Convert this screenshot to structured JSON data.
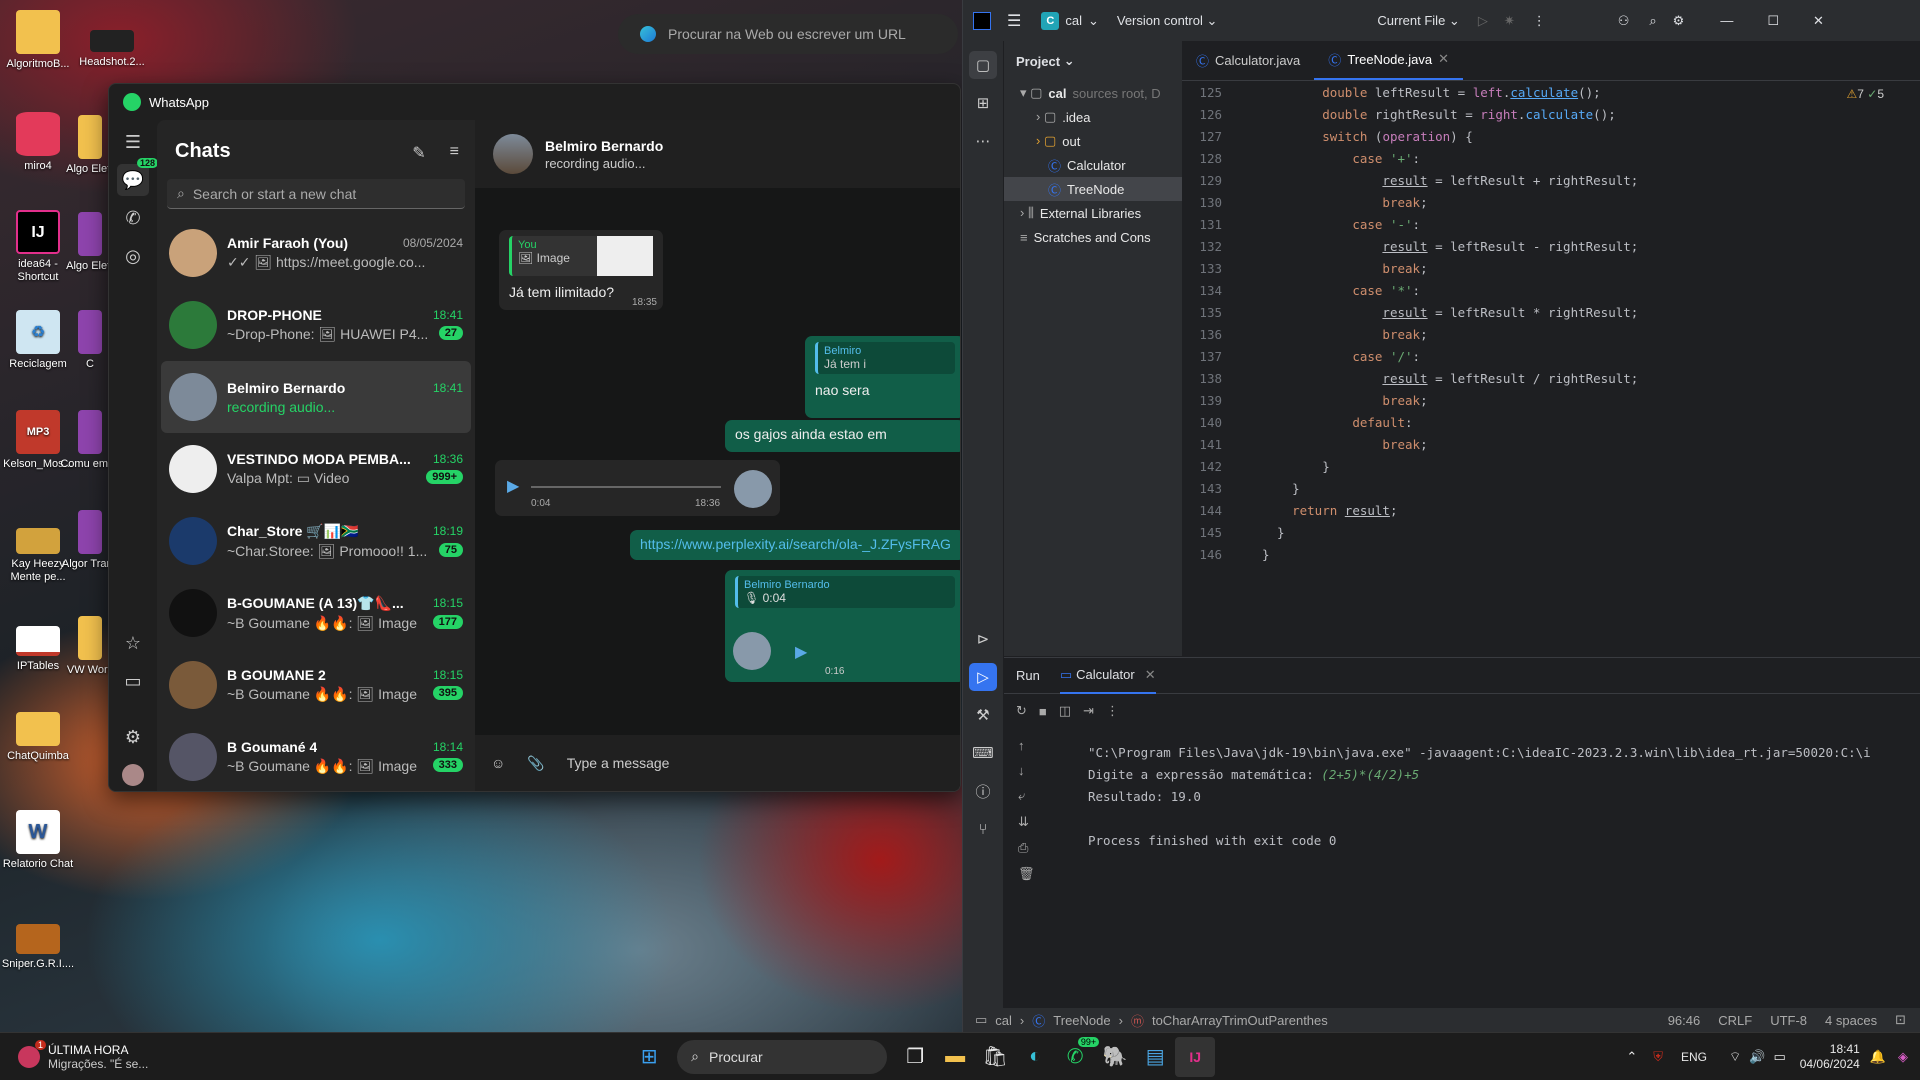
{
  "desktop": {
    "icons": [
      "AlgoritmoB...",
      "Headshot.2...",
      "miro4",
      "Algo Eletr",
      "idea64 - Shortcut",
      "Algo Eletr",
      "Reciclagem",
      "C",
      "Kelson_Mos...",
      "Comu em G",
      "Kay Heezy Mente pe...",
      "Algor Trans",
      "IPTables",
      "VW Work",
      "ChatQuimba",
      "Relatorio Chat",
      "Sniper.G.R.I...."
    ],
    "mp3_label": "MP3"
  },
  "edge": {
    "placeholder": "Procurar na Web ou escrever um URL"
  },
  "whatsapp": {
    "title": "WhatsApp",
    "rail_badge": "128",
    "chats_title": "Chats",
    "search_placeholder": "Search or start a new chat",
    "chats": [
      {
        "name": "Amir Faraoh (You)",
        "time": "08/05/2024",
        "preview": "✓✓ 🖼 https://meet.google.co...",
        "badge": ""
      },
      {
        "name": "DROP-PHONE",
        "time": "18:41",
        "preview": "~Drop-Phone: 🖼 HUAWEI P4...",
        "badge": "27"
      },
      {
        "name": "Belmiro Bernardo",
        "time": "18:41",
        "preview": "recording audio...",
        "badge": ""
      },
      {
        "name": "VESTINDO MODA PEMBA...",
        "time": "18:36",
        "preview": "Valpa Mpt: ▭ Video",
        "badge": "999+"
      },
      {
        "name": "Char_Store 🛒📊🇿🇦",
        "time": "18:19",
        "preview": "~Char.Storee: 🖼 Promooo!! 1...",
        "badge": "75"
      },
      {
        "name": "B-GOUMANE (A 13)👕👠...",
        "time": "18:15",
        "preview": "~B Goumane 🔥🔥: 🖼 Image",
        "badge": "177"
      },
      {
        "name": "B GOUMANE 2",
        "time": "18:15",
        "preview": "~B Goumane 🔥🔥: 🖼 Image",
        "badge": "395"
      },
      {
        "name": "B Goumané 4",
        "time": "18:14",
        "preview": "~B Goumane 🔥🔥: 🖼 Image",
        "badge": "333"
      }
    ],
    "conversation": {
      "contact": "Belmiro Bernardo",
      "status": "recording audio...",
      "quote_you": "You",
      "quote_image": "🖼 Image",
      "msg1": "Já tem ilimitado?",
      "msg1_time": "18:35",
      "reply_label": "Belmiro",
      "reply_text": "Já tem i",
      "msg2": "nao sera",
      "msg3": "os gajos ainda estao em",
      "audio_elapsed": "0:04",
      "audio_time": "18:36",
      "link": "https://www.perplexity.ai/search/ola-_J.ZFysFRAG",
      "quote2_name": "Belmiro Bernardo",
      "quote2_text": "🎙 0:04",
      "audio2_len": "0:16",
      "composer_placeholder": "Type a message"
    }
  },
  "ide": {
    "project": "cal",
    "vcs": "Version control",
    "run_config": "Current File",
    "panel_title": "Project",
    "tree": [
      {
        "t": "cal",
        "extra": "sources root, D"
      },
      {
        "t": ".idea"
      },
      {
        "t": "out"
      },
      {
        "t": "Calculator"
      },
      {
        "t": "TreeNode"
      },
      {
        "t": "External Libraries"
      },
      {
        "t": "Scratches and Cons"
      }
    ],
    "tabs": [
      "Calculator.java",
      "TreeNode.java"
    ],
    "inspections": {
      "warnings": "7",
      "ok": "5"
    },
    "line_numbers": [
      "125",
      "126",
      "127",
      "128",
      "129",
      "130",
      "131",
      "132",
      "133",
      "134",
      "135",
      "136",
      "137",
      "138",
      "139",
      "140",
      "141",
      "142",
      "143",
      "144",
      "145",
      "146"
    ],
    "run_tab": "Run",
    "run_config_tab": "Calculator",
    "console": [
      "\"C:\\Program Files\\Java\\jdk-19\\bin\\java.exe\" -javaagent:C:\\ideaIC-2023.2.3.win\\lib\\idea_rt.jar=50020:C:\\i",
      "Digite a expressão matemática: ",
      "Resultado: 19.0",
      "",
      "Process finished with exit code 0"
    ],
    "console_input": "(2+5)*(4/2)+5",
    "status": {
      "crumb1": "cal",
      "crumb2": "TreeNode",
      "crumb3": "toCharArrayTrimOutParenthes",
      "pos": "96:46",
      "eol": "CRLF",
      "enc": "UTF-8",
      "indent": "4 spaces"
    }
  },
  "taskbar": {
    "news_title": "ÚLTIMA HORA",
    "news_sub": "Migrações. \"É se...",
    "search": "Procurar",
    "wa_badge": "99+",
    "lang": "ENG",
    "time": "18:41",
    "date": "04/06/2024",
    "news_badge": "1"
  }
}
